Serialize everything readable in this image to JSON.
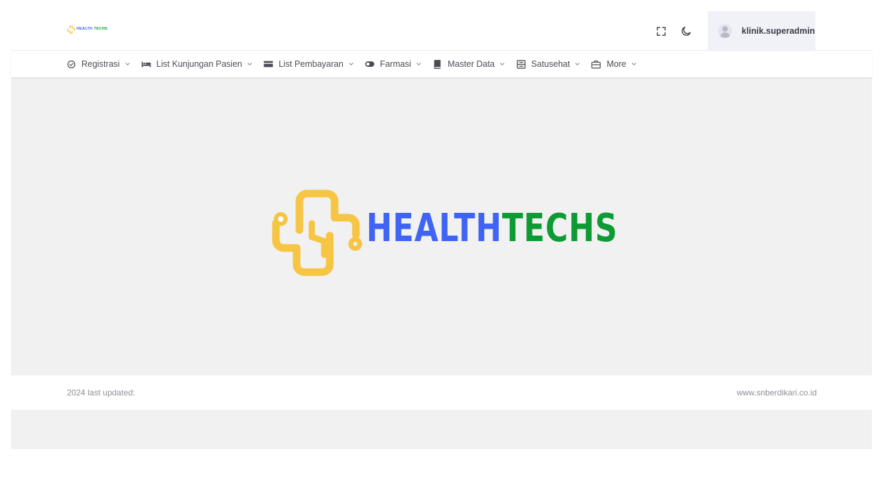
{
  "brand": {
    "text_part1": "HEALTH",
    "text_part2": "TECHS",
    "logo_icon": "medical-circuit-logo-icon"
  },
  "colors": {
    "brand_yellow": "#f7c544",
    "brand_blue": "#3f64f4",
    "brand_green": "#0e9a34",
    "page_bg": "#f1f1f1",
    "header_user_bg": "#f1f1f8"
  },
  "header": {
    "fullscreen_icon": "expand-icon",
    "theme_icon": "moon-icon",
    "user": {
      "name": "klinik.superadmin",
      "avatar_icon": "user-avatar-icon"
    }
  },
  "nav": {
    "items": [
      {
        "label": "Registrasi",
        "icon": "shield-check-icon"
      },
      {
        "label": "List Kunjungan Pasien",
        "icon": "bed-icon"
      },
      {
        "label": "List Pembayaran",
        "icon": "card-icon"
      },
      {
        "label": "Farmasi",
        "icon": "toggle-icon"
      },
      {
        "label": "Master Data",
        "icon": "book-icon"
      },
      {
        "label": "Satusehat",
        "icon": "server-icon"
      },
      {
        "label": "More",
        "icon": "briefcase-icon"
      }
    ]
  },
  "footer": {
    "left_text": "2024 last updated:",
    "right_text": "www.snberdikari.co.id"
  }
}
